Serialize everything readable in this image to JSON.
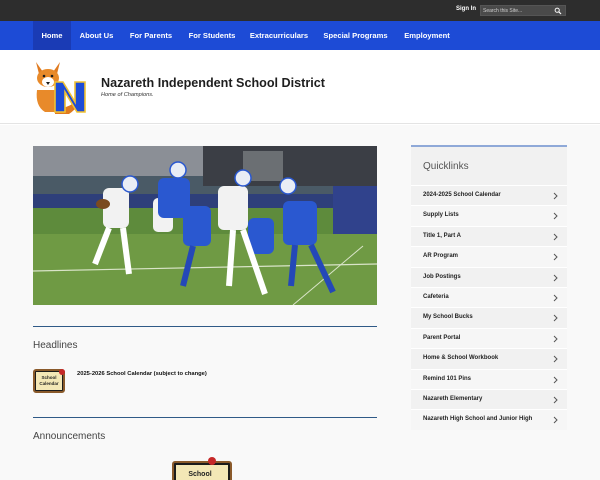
{
  "topbar": {
    "signin": "Sign In",
    "search_placeholder": "Search this Site..."
  },
  "nav": {
    "items": [
      {
        "label": "Home",
        "active": true
      },
      {
        "label": "About Us"
      },
      {
        "label": "For Parents"
      },
      {
        "label": "For Students"
      },
      {
        "label": "Extracurriculars"
      },
      {
        "label": "Special Programs"
      },
      {
        "label": "Employment"
      }
    ]
  },
  "header": {
    "district_name": "Nazareth Independent School District",
    "tagline": "Home of Champions.",
    "logo_icon": "fox-n-logo-icon"
  },
  "main": {
    "hero_image": "football-game-photo",
    "headlines_title": "Headlines",
    "headline_item": "2025-2026 School Calendar (subject to change)",
    "headline_thumb_text": "School Calendar",
    "announcements_title": "Announcements",
    "announcement_thumb_text": "School"
  },
  "quicklinks": {
    "title": "Quicklinks",
    "items": [
      "2024-2025 School Calendar",
      "Supply Lists",
      "Title 1, Part A",
      "AR Program",
      "Job Postings",
      "Cafeteria",
      "My School Bucks",
      "Parent Portal",
      "Home & School Workbook",
      "Remind 101 Pins",
      "Nazareth Elementary",
      "Nazareth High School and Junior High"
    ]
  },
  "colors": {
    "topbar": "#2d2d2d",
    "nav": "#1d4bd6",
    "nav_active": "#1a3bb5",
    "rule": "#2f5a87",
    "quicklinks_accent": "#8fa9d8"
  }
}
